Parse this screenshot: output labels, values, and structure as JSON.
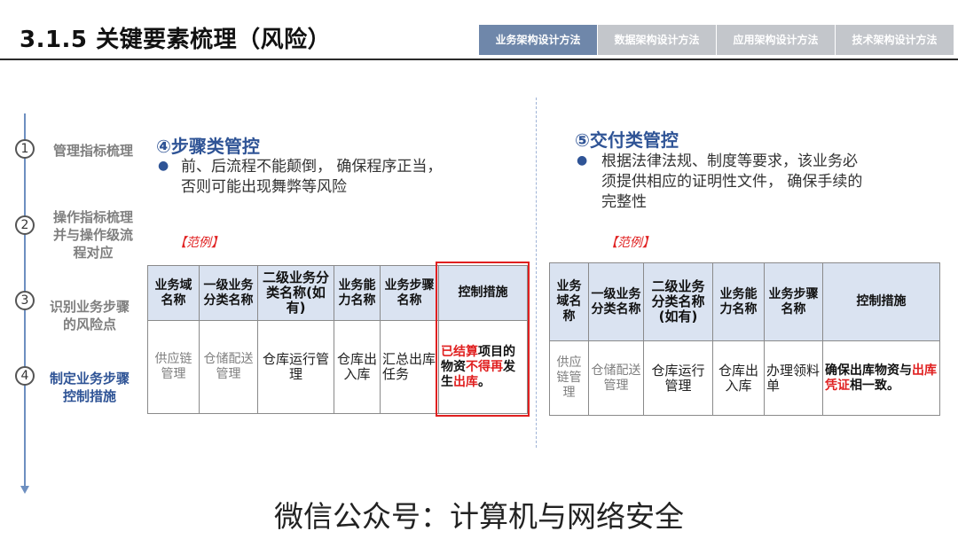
{
  "header": {
    "title": "3.1.5 关键要素梳理（风险）",
    "tabs": [
      "业务架构设计方法",
      "数据架构设计方法",
      "应用架构设计方法",
      "技术架构设计方法"
    ],
    "active_tab": 0
  },
  "sidebar": {
    "steps": [
      {
        "number": "1",
        "label": "管理指标梳理"
      },
      {
        "number": "2",
        "label": "操作指标梳理并与操作级流程对应"
      },
      {
        "number": "3",
        "label": "识别业务步骤的风险点"
      },
      {
        "number": "4",
        "label": "制定业务步骤控制措施"
      }
    ],
    "active_step": 3
  },
  "left_section": {
    "title": "④步骤类管控",
    "bullet_line1": "前、后流程不能颠倒， 确保程序正当，",
    "bullet_line2": "否则可能出现舞弊等风险",
    "example_label": "【范例】",
    "table": {
      "headers": [
        "业务域名称",
        "一级业务分类名称",
        "二级业务分类名称(如有)",
        "业务能力名称",
        "业务步骤名称",
        "控制措施"
      ],
      "row": {
        "c1": "供应链管理",
        "c2": "仓储配送管理",
        "c3": "仓库运行管理",
        "c4": "仓库出入库",
        "c5": "汇总出库任务",
        "measure_parts": {
          "p1": "已结算",
          "p2": "项目的物资",
          "p3": "不得",
          "p4": "再",
          "p5": "发生",
          "p6": "出库",
          "p7": "。"
        }
      }
    }
  },
  "right_section": {
    "title": "⑤交付类管控",
    "bullet_line1": "根据法律法规、制度等要求，该业务必",
    "bullet_line2": "须提供相应的证明性文件， 确保手续的",
    "bullet_line3": "完整性",
    "example_label": "【范例】",
    "table": {
      "headers": [
        "业务域名称",
        "一级业务分类名称",
        "二级业务分类名称(如有)",
        "业务能力名称",
        "业务步骤名称",
        "控制措施"
      ],
      "row": {
        "c1": "供应链管理",
        "c2": "仓储配送管理",
        "c3": "仓库运行管理",
        "c4": "仓库出入库",
        "c5": "办理领料单",
        "measure_parts": {
          "p1": "确保出库物资与",
          "p2": "出库凭证",
          "p3": "相一致。"
        }
      }
    }
  },
  "footer": {
    "text": "微信公众号：计算机与网络安全"
  },
  "colors": {
    "accent": "#2f5496",
    "active_tab": "#6f87aa",
    "inactive_tab": "#c3c6cb",
    "header_fill": "#dae3f1",
    "warning": "#e02020",
    "timeline": "#6d8fc0"
  }
}
